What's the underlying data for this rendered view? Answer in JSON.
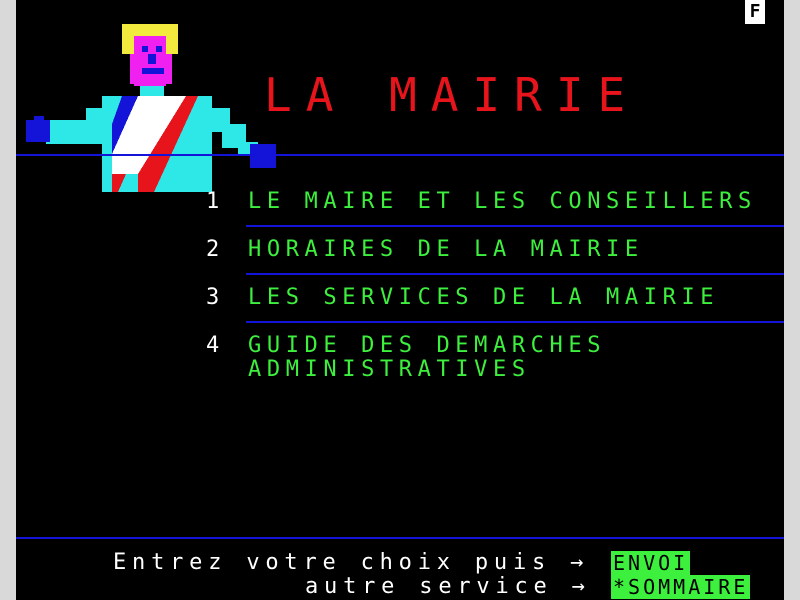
{
  "page": {
    "badge": "F",
    "title": "LA MAIRIE"
  },
  "menu": {
    "items": [
      {
        "number": "1",
        "label": "LE MAIRE ET LES CONSEILLERS"
      },
      {
        "number": "2",
        "label": "HORAIRES DE LA MAIRIE"
      },
      {
        "number": "3",
        "label": "LES SERVICES DE LA MAIRIE"
      },
      {
        "number": "4",
        "label_line1": "GUIDE DES DEMARCHES",
        "label_line2": "ADMINISTRATIVES"
      }
    ]
  },
  "footer": {
    "prompt_line1": "Entrez votre choix puis →",
    "envoi_key": "ENVOI",
    "prompt_line2": "autre service →",
    "sommaire_key": "*SOMMAIRE"
  },
  "colors": {
    "background": "#000000",
    "title": "#e8141c",
    "menu_text": "#3ef03e",
    "rule": "#1414d9",
    "key_background": "#3ef03e"
  }
}
